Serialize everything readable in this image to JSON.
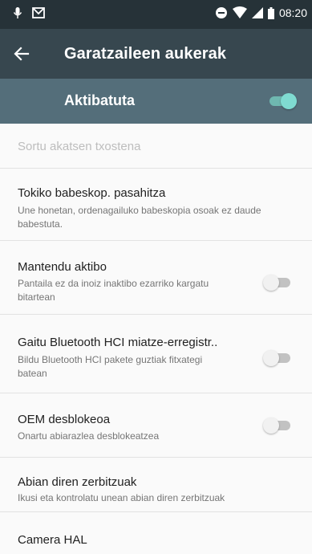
{
  "status_bar": {
    "time": "08:20"
  },
  "app_bar": {
    "title": "Garatzaileen aukerak"
  },
  "master_toggle": {
    "label": "Aktibatuta",
    "state": "on"
  },
  "items": [
    {
      "title": "Sortu akatsen txostena",
      "subtitle": "",
      "enabled": false
    },
    {
      "title": "Tokiko babeskop. pasahitza",
      "subtitle": "Une honetan, ordenagailuko babeskopia osoak ez daude babestuta.",
      "enabled": true
    },
    {
      "title": "Mantendu aktibo",
      "subtitle": "Pantaila ez da inoiz inaktibo ezarriko kargatu bitartean",
      "enabled": true,
      "switch": "off"
    },
    {
      "title": "Gaitu Bluetooth HCI miatze-erregistr..",
      "subtitle": "Bildu Bluetooth HCI pakete guztiak fitxategi batean",
      "enabled": true,
      "switch": "off"
    },
    {
      "title": "OEM desblokeoa",
      "subtitle": "Onartu abiarazlea desblokeatzea",
      "enabled": true,
      "switch": "off"
    },
    {
      "title": "Abian diren zerbitzuak",
      "subtitle": "Ikusi eta kontrolatu unean abian diren zerbitzuak",
      "enabled": true
    },
    {
      "title": "Camera HAL",
      "subtitle": "",
      "enabled": true
    }
  ],
  "colors": {
    "status_bar": "#263238",
    "app_bar": "#37474f",
    "master_bar": "#546e7a",
    "accent": "#80cbc4"
  }
}
